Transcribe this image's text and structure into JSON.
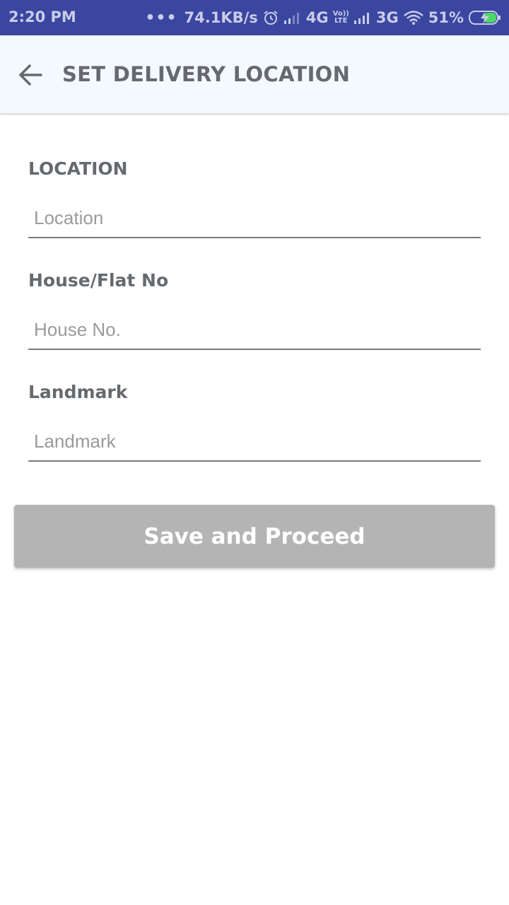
{
  "status_bar": {
    "time": "2:20 PM",
    "more": "•••",
    "network_speed": "74.1KB/s",
    "sim1_type": "4G",
    "volte_top": "Vo))",
    "volte_bottom": "LTE",
    "sim2_type": "3G",
    "battery": "51%",
    "icons": [
      "alarm-icon",
      "signal-icon",
      "wifi-icon",
      "battery-charging-icon"
    ]
  },
  "app_bar": {
    "title": "SET DELIVERY LOCATION",
    "back_icon": "arrow-back-icon"
  },
  "form": {
    "location": {
      "label": "LOCATION",
      "placeholder": "Location",
      "value": ""
    },
    "house": {
      "label": "House/Flat No",
      "placeholder": "House No.",
      "value": ""
    },
    "landmark": {
      "label": "Landmark",
      "placeholder": "Landmark",
      "value": ""
    }
  },
  "actions": {
    "save_label": "Save and Proceed"
  },
  "colors": {
    "status_bar_bg": "#3a46a0",
    "app_bar_bg": "#f3f9fd",
    "title_text": "#666a6e",
    "button_disabled_bg": "#b4b4b4",
    "button_text": "#ffffff"
  }
}
